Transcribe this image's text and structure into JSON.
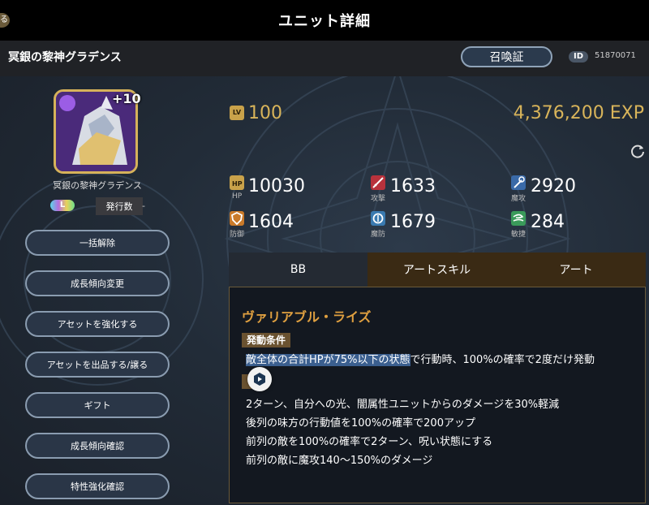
{
  "header": {
    "title": "ユニット詳細",
    "back": "る"
  },
  "unit": {
    "name": "冥銀の黎神グラデンス",
    "portrait_name": "冥銀の黎神グラデンス",
    "plus": "+10",
    "rarity": "L",
    "issue_label": "発行数",
    "issue_value": "-"
  },
  "summon_button": "召喚証",
  "id": {
    "label": "ID",
    "value": "51870071"
  },
  "level": {
    "icon": "LV",
    "value": "100",
    "exp": "4,376,200 EXP"
  },
  "stats": [
    {
      "name": "hp",
      "label": "HP",
      "value": "10030",
      "icon": "hp-icon"
    },
    {
      "name": "atk",
      "label": "攻撃",
      "value": "1633",
      "icon": "sword-icon"
    },
    {
      "name": "matk",
      "label": "魔攻",
      "value": "2920",
      "icon": "wand-icon"
    },
    {
      "name": "def",
      "label": "防御",
      "value": "1604",
      "icon": "shield-icon"
    },
    {
      "name": "mdef",
      "label": "魔防",
      "value": "1679",
      "icon": "magic-shield-icon"
    },
    {
      "name": "agi",
      "label": "敏捷",
      "value": "284",
      "icon": "wind-icon"
    }
  ],
  "menu": [
    "一括解除",
    "成長傾向変更",
    "アセットを強化する",
    "アセットを出品する/譲る",
    "ギフト",
    "成長傾向確認",
    "特性強化確認"
  ],
  "tabs": [
    {
      "label": "BB",
      "active": true
    },
    {
      "label": "アートスキル",
      "active": false
    },
    {
      "label": "アート",
      "active": false
    }
  ],
  "skill": {
    "name": "ヴァリアブル・ライズ",
    "condition_tag": "発動条件",
    "condition_highlight": "敵全体の合計HPが75%以下の状態",
    "condition_rest": "で行動時、100%の確率で2度だけ発動",
    "effects": [
      "2ターン、自分への光、闇属性ユニットからのダメージを30%軽減",
      "後列の味方の行動値を100%の確率で200アップ",
      "前列の敵を100%の確率で2ターン、呪い状態にする",
      "前列の敵に魔攻140〜150%のダメージ"
    ]
  },
  "colors": {
    "gold": "#d8b45a",
    "skill_name": "#e0a040",
    "tag": "#6a5230",
    "highlight": "#3b5f8f"
  }
}
